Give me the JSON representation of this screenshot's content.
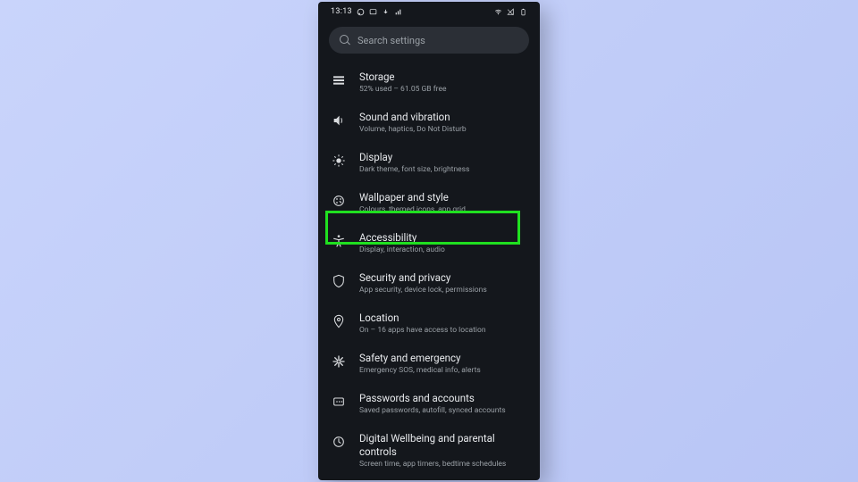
{
  "statusbar": {
    "time": "13:13",
    "left_icons": [
      "whatsapp-icon",
      "cast-icon",
      "update-icon",
      "bars-icon"
    ],
    "right_icons": [
      "wifi-icon",
      "signal-icon",
      "battery-icon"
    ]
  },
  "search": {
    "placeholder": "Search settings"
  },
  "items": [
    {
      "icon": "storage-icon",
      "title": "Storage",
      "sub": "52% used – 61.05 GB free"
    },
    {
      "icon": "sound-icon",
      "title": "Sound and vibration",
      "sub": "Volume, haptics, Do Not Disturb"
    },
    {
      "icon": "display-icon",
      "title": "Display",
      "sub": "Dark theme, font size, brightness"
    },
    {
      "icon": "wallpaper-icon",
      "title": "Wallpaper and style",
      "sub": "Colours, themed icons, app grid"
    },
    {
      "icon": "accessibility-icon",
      "title": "Accessibility",
      "sub": "Display, interaction, audio"
    },
    {
      "icon": "security-icon",
      "title": "Security and privacy",
      "sub": "App security, device lock, permissions"
    },
    {
      "icon": "location-icon",
      "title": "Location",
      "sub": "On – 16 apps have access to location"
    },
    {
      "icon": "safety-icon",
      "title": "Safety and emergency",
      "sub": "Emergency SOS, medical info, alerts"
    },
    {
      "icon": "passwords-icon",
      "title": "Passwords and accounts",
      "sub": "Saved passwords, autofill, synced accounts"
    },
    {
      "icon": "wellbeing-icon",
      "title": "Digital Wellbeing and parental controls",
      "sub": "Screen time, app timers, bedtime schedules"
    }
  ],
  "highlight_index": 3
}
